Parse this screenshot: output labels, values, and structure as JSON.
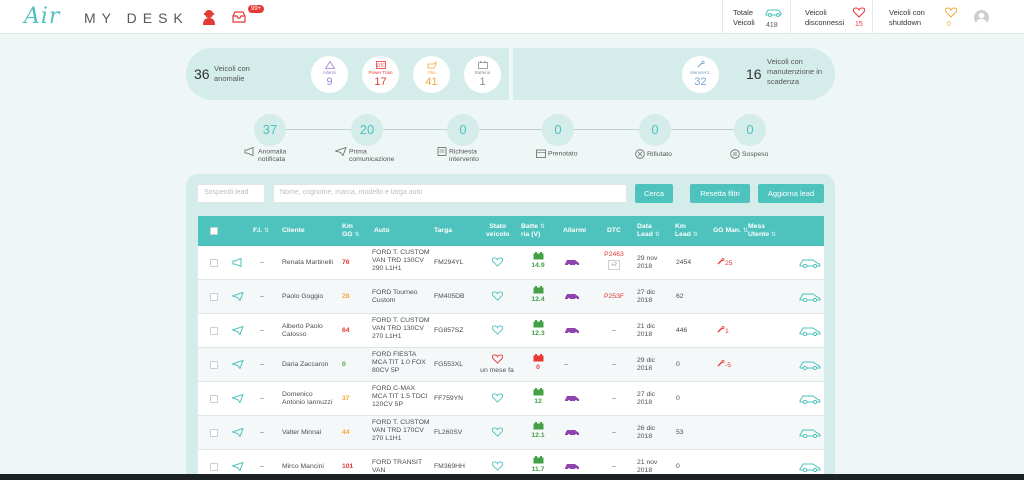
{
  "header": {
    "logo_air": "Air",
    "logo_desk": "MY DESK",
    "inbox_badge": "99+",
    "stats": [
      {
        "label1": "Totale",
        "label2": "Veicoli",
        "value": "418",
        "color": "#555a60"
      },
      {
        "label1": "Veicoli",
        "label2": "disconnessi",
        "value": "15",
        "color": "#e53935"
      },
      {
        "label1": "Veicoli con",
        "label2": "shutdown",
        "value": "0",
        "color": "#f4a83a"
      }
    ]
  },
  "anomalies": {
    "count": "36",
    "label_line1": "Veicoli con",
    "label_line2": "anomalie",
    "circles": [
      {
        "label": "Allarmi",
        "value": "9",
        "color": "#9b7fd6"
      },
      {
        "label": "Power Train",
        "value": "17",
        "color": "#e53935"
      },
      {
        "label": "Olio",
        "value": "41",
        "color": "#f4a83a"
      },
      {
        "label": "Batteria",
        "value": "1",
        "color": "#8a9096"
      }
    ]
  },
  "maintenance": {
    "circle_label": "Manutenz.",
    "circle_value": "32",
    "count": "16",
    "label_line1": "Veicoli con",
    "label_line2": "manutenzione in",
    "label_line3": "scadenza"
  },
  "steps": [
    {
      "value": "37",
      "line1": "Anomalia",
      "line2": "notificata"
    },
    {
      "value": "20",
      "line1": "Prima",
      "line2": "comunicazione"
    },
    {
      "value": "0",
      "line1": "Richiesta",
      "line2": "intervento"
    },
    {
      "value": "0",
      "line1": "Prenotato",
      "line2": ""
    },
    {
      "value": "0",
      "line1": "Rifiutato",
      "line2": ""
    },
    {
      "value": "0",
      "line1": "Sospeso",
      "line2": ""
    }
  ],
  "toolbar": {
    "sospendi_placeholder": "Sospendi lead",
    "search_placeholder": "Nome, cognome, marca, modello e targa auto",
    "cerca": "Cerca",
    "reset": "Resetta filtri",
    "aggiorna": "Aggiorna lead"
  },
  "table": {
    "headers": {
      "fi": "F.I.",
      "cliente": "Cliente",
      "km_gg_1": "Km",
      "km_gg_2": "GG",
      "auto": "Auto",
      "targa": "Targa",
      "stato_1": "Stato",
      "stato_2": "veicolo",
      "batt_1": "Batte",
      "batt_2": "ria (V)",
      "allarmi": "Allarmi",
      "dtc": "DTC",
      "data_1": "Data",
      "data_2": "Lead",
      "kmlead_1": "Km",
      "kmlead_2": "Lead",
      "ggman": "GG Man.",
      "mess_1": "Mess",
      "mess_2": "Utente"
    },
    "rows": [
      {
        "icon": "megaphone",
        "fi": "–",
        "cliente1": "Renata Martinelli",
        "cliente2": "",
        "kmgg": "76",
        "kmgg_color": "#e53935",
        "auto1": "FORD T. CUSTOM",
        "auto2": "VAN TRD 130CV",
        "auto3": "290 L1H1",
        "targa": "FM294YL",
        "stato": "ok",
        "stato_text": "",
        "batt": "14.9",
        "batt_color": "#43a047",
        "alarm": "car",
        "dtc1": "P2463",
        "dtc2": "+2",
        "data1": "29 nov",
        "data2": "2018",
        "kmlead": "2454",
        "ggman": "25"
      },
      {
        "icon": "plane",
        "fi": "–",
        "cliente1": "Paolo Goggio",
        "cliente2": "",
        "kmgg": "28",
        "kmgg_color": "#f4a83a",
        "auto1": "FORD Tourneo",
        "auto2": "Custom",
        "auto3": "",
        "targa": "FM405DB",
        "stato": "ok",
        "stato_text": "",
        "batt": "12.4",
        "batt_color": "#43a047",
        "alarm": "car",
        "dtc1": "P253F",
        "dtc2": "",
        "data1": "27 dic",
        "data2": "2018",
        "kmlead": "62",
        "ggman": ""
      },
      {
        "icon": "plane",
        "fi": "–",
        "cliente1": "Alberto Paolo",
        "cliente2": "Calosso",
        "kmgg": "64",
        "kmgg_color": "#e53935",
        "auto1": "FORD T. CUSTOM",
        "auto2": "VAN TRD 130CV",
        "auto3": "270 L1H1",
        "targa": "FG857SZ",
        "stato": "ok",
        "stato_text": "",
        "batt": "12.3",
        "batt_color": "#43a047",
        "alarm": "car",
        "dtc1": "–",
        "dtc2": "",
        "data1": "21 dic",
        "data2": "2018",
        "kmlead": "446",
        "ggman": "1"
      },
      {
        "icon": "plane",
        "fi": "–",
        "cliente1": "Daria Zaccaron",
        "cliente2": "",
        "kmgg": "0",
        "kmgg_color": "#43a047",
        "auto1": "FORD FIESTA",
        "auto2": "MCA TIT 1.0 FOX",
        "auto3": "80CV 5P",
        "targa": "FG553XL",
        "stato": "bad",
        "stato_text": "un mese fa",
        "batt": "0",
        "batt_color": "#e53935",
        "alarm": "–",
        "dtc1": "–",
        "dtc2": "",
        "data1": "29 dic",
        "data2": "2018",
        "kmlead": "0",
        "ggman": "-5"
      },
      {
        "icon": "plane",
        "fi": "–",
        "cliente1": "Domenico",
        "cliente2": "Antonio Iannuzzi",
        "kmgg": "37",
        "kmgg_color": "#f4a83a",
        "auto1": "FORD C-MAX",
        "auto2": "MCA TIT 1.5 TDCI",
        "auto3": "120CV 5P",
        "targa": "FF759YN",
        "stato": "ok",
        "stato_text": "",
        "batt": "12",
        "batt_color": "#43a047",
        "alarm": "car",
        "dtc1": "–",
        "dtc2": "",
        "data1": "27 dic",
        "data2": "2018",
        "kmlead": "0",
        "ggman": ""
      },
      {
        "icon": "plane",
        "fi": "–",
        "cliente1": "Valter Minnai",
        "cliente2": "",
        "kmgg": "44",
        "kmgg_color": "#f4a83a",
        "auto1": "FORD T. CUSTOM",
        "auto2": "VAN TRD 170CV",
        "auto3": "270 L1H1",
        "targa": "FL260SV",
        "stato": "ok",
        "stato_text": "",
        "batt": "12.1",
        "batt_color": "#43a047",
        "alarm": "car",
        "dtc1": "–",
        "dtc2": "",
        "data1": "26 dic",
        "data2": "2018",
        "kmlead": "53",
        "ggman": ""
      },
      {
        "icon": "plane",
        "fi": "–",
        "cliente1": "Mirco Mancini",
        "cliente2": "",
        "kmgg": "101",
        "kmgg_color": "#e53935",
        "auto1": "FORD TRANSIT",
        "auto2": "VAN",
        "auto3": "",
        "targa": "FM369HH",
        "stato": "ok",
        "stato_text": "",
        "batt": "11.7",
        "batt_color": "#43a047",
        "alarm": "car",
        "dtc1": "–",
        "dtc2": "",
        "data1": "21 nov",
        "data2": "2018",
        "kmlead": "0",
        "ggman": ""
      }
    ]
  },
  "colors": {
    "accent": "#4ec2bd",
    "panel": "#d4ecea",
    "danger": "#e53935",
    "warning": "#f4a83a",
    "success": "#43a047"
  }
}
